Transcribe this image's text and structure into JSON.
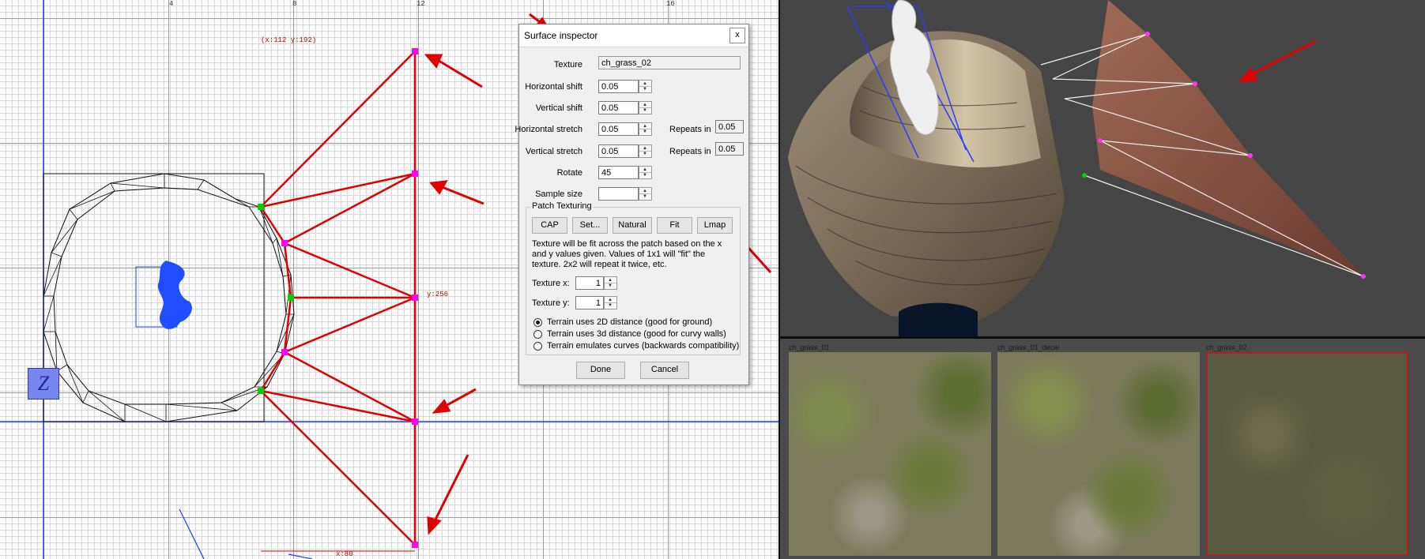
{
  "grid": {
    "coord_readout": "(x:112  y:192)",
    "y_label": "y:256",
    "x_label": "x:80",
    "ruler_top": [
      "4",
      "8",
      "12",
      "16"
    ],
    "axis_indicator": "Z"
  },
  "dialog": {
    "title": "Surface inspector",
    "close_label": "x",
    "texture_label": "Texture",
    "texture_value": "ch_grass_02",
    "fields": [
      {
        "label": "Horizontal shift",
        "value": "0.05"
      },
      {
        "label": "Vertical shift",
        "value": "0.05"
      },
      {
        "label": "Horizontal stretch",
        "value": "0.05"
      },
      {
        "label": "Vertical stretch",
        "value": "0.05"
      },
      {
        "label": "Rotate",
        "value": "45"
      },
      {
        "label": "Sample size",
        "value": ""
      }
    ],
    "repeats": [
      {
        "label": "Repeats in",
        "value": "0.05"
      },
      {
        "label": "Repeats in",
        "value": "0.05"
      }
    ],
    "patch_group_title": "Patch Texturing",
    "patch_buttons": [
      "CAP",
      "Set...",
      "Natural",
      "Fit",
      "Lmap"
    ],
    "description": "Texture will be fit across the patch based on the x and y values given. Values of 1x1 will \"fit\" the texture. 2x2 will repeat it twice, etc.",
    "texture_x_label": "Texture x:",
    "texture_x_value": "1",
    "texture_y_label": "Texture y:",
    "texture_y_value": "1",
    "radios": [
      {
        "label": "Terrain uses 2D distance (good for ground)",
        "checked": true
      },
      {
        "label": "Terrain uses 3d distance (good for curvy walls)",
        "checked": false
      },
      {
        "label": "Terrain emulates curves (backwards compatibility)",
        "checked": false
      }
    ],
    "done_label": "Done",
    "cancel_label": "Cancel"
  },
  "textures": [
    {
      "name": "ch_grass_01",
      "selected": false
    },
    {
      "name": "ch_grass_01_decal",
      "selected": false
    },
    {
      "name": "ch_grass_02",
      "selected": true
    }
  ],
  "colors": {
    "patch_edge": "#e00000",
    "grid_selection": "#1f3cff",
    "control_point_magenta": "#ff00ff",
    "control_point_green": "#00d000",
    "selected_texture_border": "#b21f1f"
  },
  "icons": [
    "z-axis-icon",
    "close-icon",
    "spin-up-icon",
    "spin-down-icon"
  ]
}
